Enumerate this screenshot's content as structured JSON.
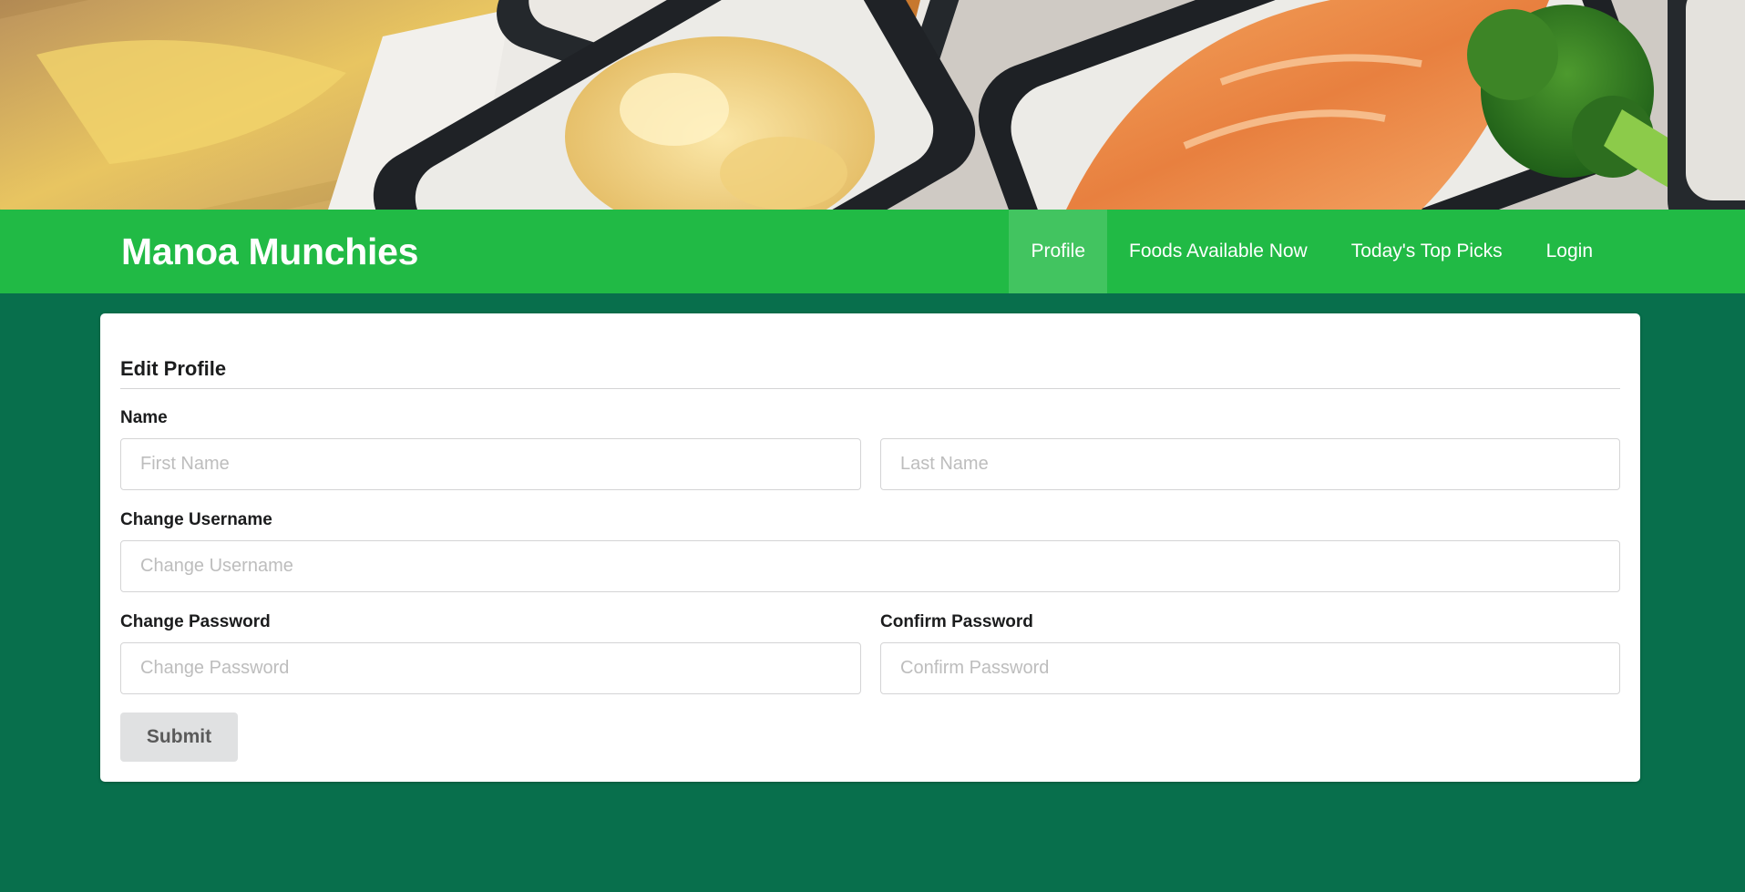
{
  "brand": {
    "title": "Manoa Munchies"
  },
  "nav": {
    "items": [
      {
        "label": "Profile",
        "active": true
      },
      {
        "label": "Foods Available Now",
        "active": false
      },
      {
        "label": "Today's Top Picks",
        "active": false
      },
      {
        "label": "Login",
        "active": false
      }
    ]
  },
  "form": {
    "title": "Edit Profile",
    "name_label": "Name",
    "first_name_placeholder": "First Name",
    "last_name_placeholder": "Last Name",
    "username_label": "Change Username",
    "username_placeholder": "Change Username",
    "password_label": "Change Password",
    "password_placeholder": "Change Password",
    "confirm_label": "Confirm Password",
    "confirm_placeholder": "Confirm Password",
    "submit_label": "Submit"
  },
  "colors": {
    "navbar": "#21ba45",
    "page_background": "#086f4c",
    "card": "#ffffff",
    "submit_button": "#e0e1e2"
  }
}
